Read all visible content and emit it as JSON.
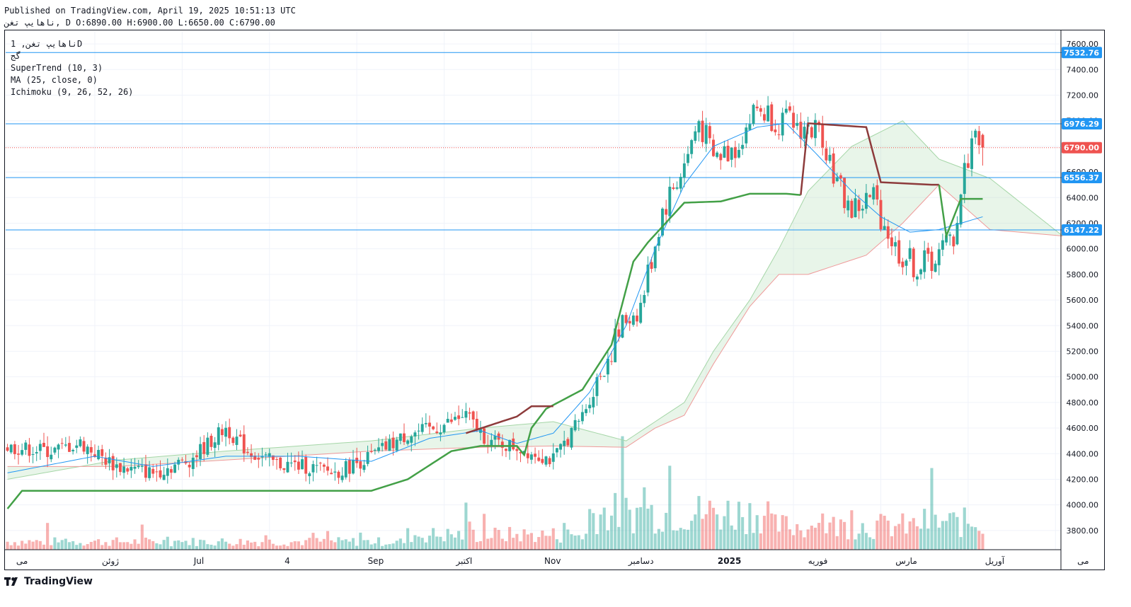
{
  "header": {
    "published": "Published on TradingView.com, April 19, 2025 10:51:13 UTC",
    "symbol_line": "ناهایپ تغن, D O:6890.00 H:6900.00 L:6650.00 C:6790.00"
  },
  "legend": {
    "title": "ناهایپ تغن, 1D",
    "exchange": "گج",
    "ind1": "SuperTrend (10, 3)",
    "ind2": "MA (25, close, 0)",
    "ind3": "Ichimoku (9, 26, 52, 26)"
  },
  "footer": {
    "brand": "TradingView"
  },
  "colors": {
    "up": "#26a69a",
    "down": "#ef5350",
    "ma": "#2196f3",
    "st_up": "#43a047",
    "st_down": "#8d3b3b",
    "hline": "#2196f3",
    "last": "#ef5350"
  },
  "chart_data": {
    "type": "candlestick",
    "ylim": [
      3650,
      7700
    ],
    "y_ticks": [
      3800,
      4000,
      4200,
      4400,
      4600,
      4800,
      5000,
      5200,
      5400,
      5600,
      5800,
      6000,
      6200,
      6400,
      6600,
      6800,
      7000,
      7200,
      7400,
      7600
    ],
    "x_labels": [
      "می",
      "ژوئن",
      "Jul",
      "4",
      "Sep",
      "اکتبر",
      "Nov",
      "دسامبر",
      "2025",
      "فوریه",
      "مارس",
      "آوریل",
      "می"
    ],
    "x_label_months": [
      0,
      1,
      2,
      3,
      4,
      5,
      6,
      7,
      8,
      9,
      10,
      11,
      12
    ],
    "horizontal_levels": [
      7532.76,
      6976.29,
      6556.37,
      6147.22
    ],
    "last_price": 6790.0,
    "price_tags": [
      {
        "text": "7532.76",
        "value": 7532.76,
        "color": "#2196f3"
      },
      {
        "text": "6976.29",
        "value": 6976.29,
        "color": "#2196f3"
      },
      {
        "text": "6790.00",
        "value": 6790.0,
        "color": "#ef5350"
      },
      {
        "text": "6556.37",
        "value": 6556.37,
        "color": "#2196f3"
      },
      {
        "text": "6147.22",
        "value": 6147.22,
        "color": "#2196f3"
      }
    ],
    "close_path": [
      [
        0,
        4450
      ],
      [
        12,
        4420
      ],
      [
        20,
        4480
      ],
      [
        30,
        4300
      ],
      [
        40,
        4250
      ],
      [
        50,
        4350
      ],
      [
        60,
        4600
      ],
      [
        66,
        4420
      ],
      [
        74,
        4320
      ],
      [
        82,
        4300
      ],
      [
        90,
        4250
      ],
      [
        100,
        4380
      ],
      [
        110,
        4550
      ],
      [
        118,
        4600
      ],
      [
        126,
        4700
      ],
      [
        132,
        4500
      ],
      [
        140,
        4450
      ],
      [
        150,
        4350
      ],
      [
        158,
        4700
      ],
      [
        164,
        5100
      ],
      [
        170,
        5450
      ],
      [
        174,
        5550
      ],
      [
        180,
        6300
      ],
      [
        186,
        6650
      ],
      [
        190,
        7000
      ],
      [
        194,
        6700
      ],
      [
        200,
        6800
      ],
      [
        206,
        7100
      ],
      [
        212,
        7000
      ],
      [
        218,
        6950
      ],
      [
        224,
        6900
      ],
      [
        228,
        6500
      ],
      [
        232,
        6300
      ],
      [
        238,
        6400
      ],
      [
        244,
        6000
      ],
      [
        250,
        5850
      ],
      [
        256,
        5950
      ],
      [
        260,
        6100
      ],
      [
        263,
        6600
      ],
      [
        266,
        6950
      ],
      [
        268,
        6790
      ]
    ],
    "ohlc_last": {
      "open": 6890.0,
      "high": 6900.0,
      "low": 6650.0,
      "close": 6790.0
    },
    "ma_path": [
      [
        0,
        4250
      ],
      [
        24,
        4380
      ],
      [
        40,
        4300
      ],
      [
        60,
        4380
      ],
      [
        80,
        4380
      ],
      [
        100,
        4340
      ],
      [
        116,
        4520
      ],
      [
        130,
        4580
      ],
      [
        140,
        4480
      ],
      [
        150,
        4560
      ],
      [
        160,
        4880
      ],
      [
        170,
        5400
      ],
      [
        178,
        6000
      ],
      [
        186,
        6500
      ],
      [
        194,
        6800
      ],
      [
        206,
        6950
      ],
      [
        214,
        6980
      ],
      [
        222,
        6750
      ],
      [
        232,
        6450
      ],
      [
        240,
        6250
      ],
      [
        248,
        6130
      ],
      [
        256,
        6150
      ],
      [
        262,
        6200
      ],
      [
        268,
        6250
      ]
    ],
    "supertrend": [
      {
        "trend": "up",
        "path": [
          [
            0,
            3970
          ],
          [
            4,
            4110
          ],
          [
            100,
            4110
          ],
          [
            110,
            4200
          ],
          [
            122,
            4420
          ],
          [
            130,
            4460
          ],
          [
            140,
            4460
          ],
          [
            142,
            4390
          ],
          [
            144,
            4600
          ],
          [
            148,
            4750
          ],
          [
            158,
            4900
          ],
          [
            166,
            5250
          ],
          [
            172,
            5900
          ],
          [
            176,
            6050
          ],
          [
            186,
            6360
          ],
          [
            196,
            6370
          ],
          [
            204,
            6430
          ],
          [
            214,
            6430
          ],
          [
            218,
            6420
          ]
        ]
      },
      {
        "trend": "down",
        "path": [
          [
            126,
            4560
          ],
          [
            140,
            4690
          ],
          [
            144,
            4770
          ],
          [
            150,
            4770
          ]
        ]
      },
      {
        "trend": "down",
        "path": [
          [
            218,
            6420
          ],
          [
            220,
            6980
          ],
          [
            236,
            6950
          ],
          [
            240,
            6520
          ],
          [
            254,
            6500
          ],
          [
            256,
            6500
          ]
        ]
      },
      {
        "trend": "up",
        "path": [
          [
            256,
            6500
          ],
          [
            258,
            6100
          ],
          [
            262,
            6390
          ],
          [
            268,
            6390
          ]
        ]
      }
    ],
    "cloud_upper": [
      [
        0,
        4200
      ],
      [
        30,
        4350
      ],
      [
        60,
        4420
      ],
      [
        100,
        4500
      ],
      [
        130,
        4600
      ],
      [
        150,
        4650
      ],
      [
        170,
        4500
      ],
      [
        178,
        4650
      ],
      [
        186,
        4800
      ],
      [
        194,
        5200
      ],
      [
        204,
        5600
      ],
      [
        212,
        6000
      ],
      [
        220,
        6450
      ],
      [
        232,
        6800
      ],
      [
        246,
        7000
      ],
      [
        256,
        6700
      ],
      [
        270,
        6550
      ],
      [
        290,
        6100
      ]
    ],
    "cloud_lower": [
      [
        0,
        4300
      ],
      [
        30,
        4300
      ],
      [
        60,
        4350
      ],
      [
        100,
        4420
      ],
      [
        130,
        4450
      ],
      [
        150,
        4460
      ],
      [
        170,
        4450
      ],
      [
        178,
        4600
      ],
      [
        186,
        4700
      ],
      [
        194,
        5100
      ],
      [
        204,
        5550
      ],
      [
        212,
        5800
      ],
      [
        220,
        5800
      ],
      [
        236,
        5950
      ],
      [
        246,
        6200
      ],
      [
        256,
        6500
      ],
      [
        270,
        6150
      ],
      [
        290,
        6100
      ]
    ],
    "volume": [
      {
        "region": "May-Jul",
        "relative": "low"
      },
      {
        "region": "Aug-Oct",
        "relative": "low-medium"
      },
      {
        "region": "Dec-Jan",
        "relative": "high"
      },
      {
        "region": "Apr",
        "relative": "medium"
      }
    ]
  }
}
